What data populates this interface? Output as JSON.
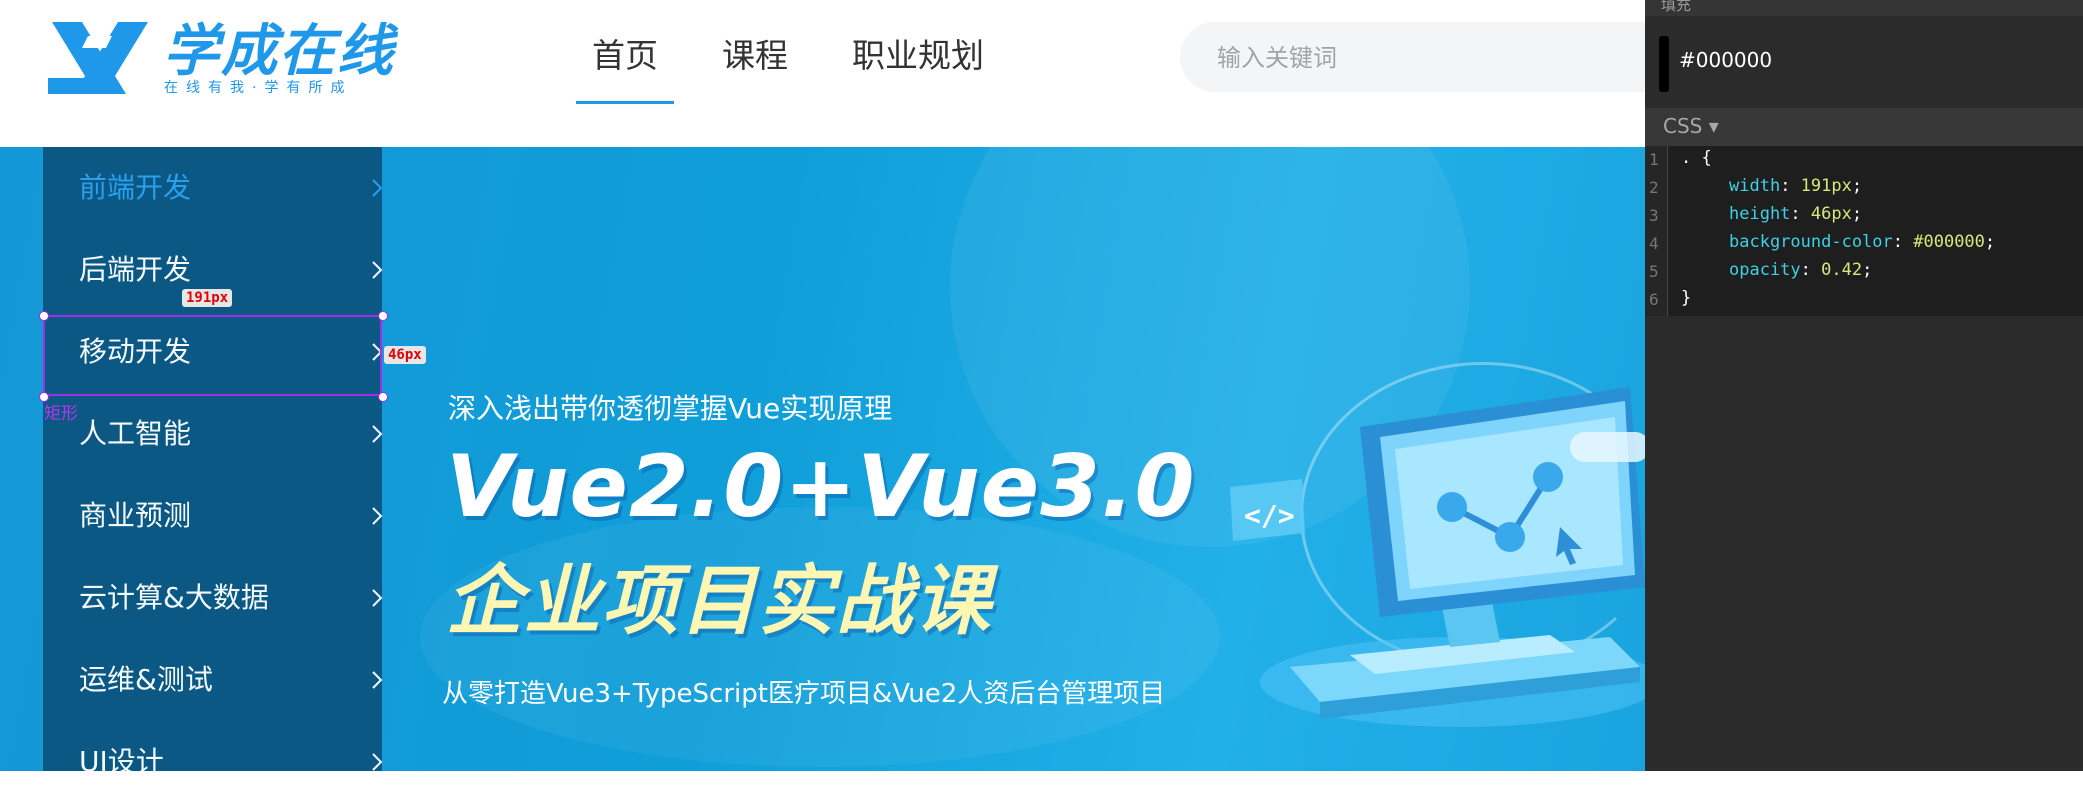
{
  "header": {
    "logo_title": "学成在线",
    "logo_slogan": "在线有我·学有所成",
    "nav": [
      {
        "label": "首页",
        "active": true
      },
      {
        "label": "课程",
        "active": false
      },
      {
        "label": "职业规划",
        "active": false
      }
    ],
    "search_placeholder": "输入关键词"
  },
  "sidebar": {
    "items": [
      {
        "label": "前端开发",
        "active": true
      },
      {
        "label": "后端开发",
        "active": false
      },
      {
        "label": "移动开发",
        "active": false
      },
      {
        "label": "人工智能",
        "active": false
      },
      {
        "label": "商业预测",
        "active": false
      },
      {
        "label": "云计算&大数据",
        "active": false
      },
      {
        "label": "运维&测试",
        "active": false
      },
      {
        "label": "UI设计",
        "active": false
      }
    ]
  },
  "banner": {
    "subtitle": "深入浅出带你透彻掌握Vue实现原理",
    "title_line1": "Vue2.0+Vue3.0",
    "title_line2": "企业项目实战课",
    "description": "从零打造Vue3+TypeScript医疗项目&Vue2人资后台管理项目"
  },
  "measurement": {
    "width_label": "191px",
    "height_label": "46px",
    "layer_name": "矩形"
  },
  "panel": {
    "section_label": "填充",
    "fill_value": "#000000",
    "css_label": "CSS ▾",
    "code_lines": [
      {
        "n": "1",
        "text": ". {"
      },
      {
        "n": "2",
        "prop": "width",
        "val": "191px"
      },
      {
        "n": "3",
        "prop": "height",
        "val": "46px"
      },
      {
        "n": "4",
        "prop": "background-color",
        "val": "#000000"
      },
      {
        "n": "5",
        "prop": "opacity",
        "val": "0.42"
      },
      {
        "n": "6",
        "text": "}"
      }
    ]
  },
  "colors": {
    "brand_blue": "#1f98ea",
    "sidebar_bg": "#0b5682",
    "banner_yellow": "#fef6b3",
    "selection_purple": "#a12ee6"
  }
}
